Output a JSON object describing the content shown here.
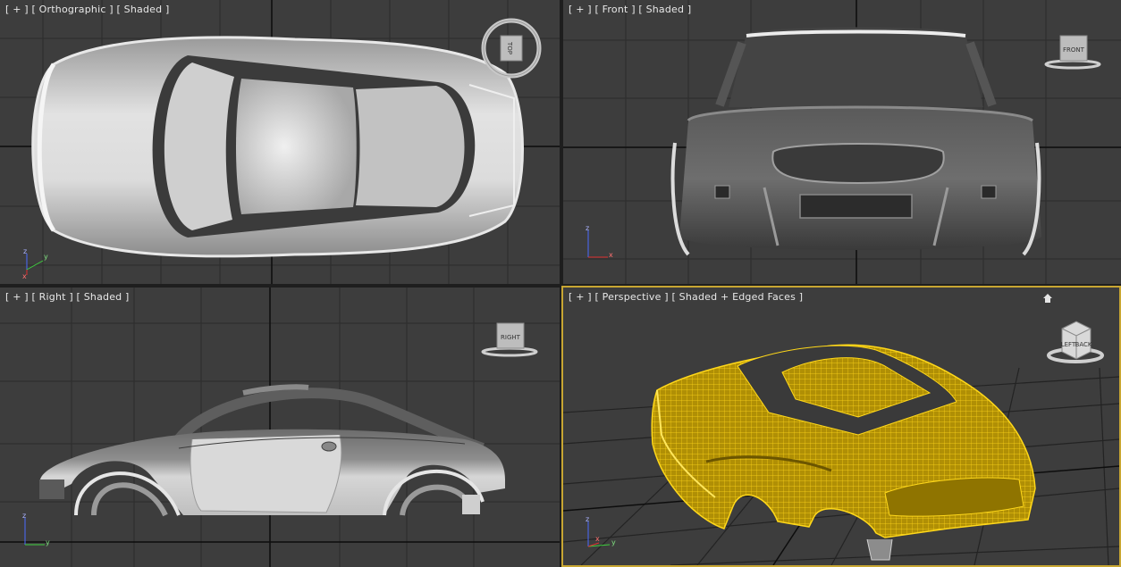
{
  "viewports": [
    {
      "id": "top",
      "label": "[ + ] [ Orthographic ] [ Shaded ]",
      "cube": "TOP",
      "active": false
    },
    {
      "id": "front",
      "label": "[ + ] [ Front ] [ Shaded ]",
      "cube": "FRONT",
      "active": false
    },
    {
      "id": "right",
      "label": "[ + ] [ Right ] [ Shaded ]",
      "cube": "RIGHT",
      "active": false
    },
    {
      "id": "persp",
      "label": "[ + ] [ Perspective ] [ Shaded + Edged Faces ]",
      "cube_left": "LEFT",
      "cube_right": "BACK",
      "active": true
    }
  ],
  "axes": {
    "x": "x",
    "y": "y",
    "z": "z"
  },
  "colors": {
    "viewport_bg": "#3d3d3d",
    "grid": "#2a2a2a",
    "active_border": "#c8a632",
    "wireframe": "#d9b400",
    "model": "#c9c9c9"
  }
}
